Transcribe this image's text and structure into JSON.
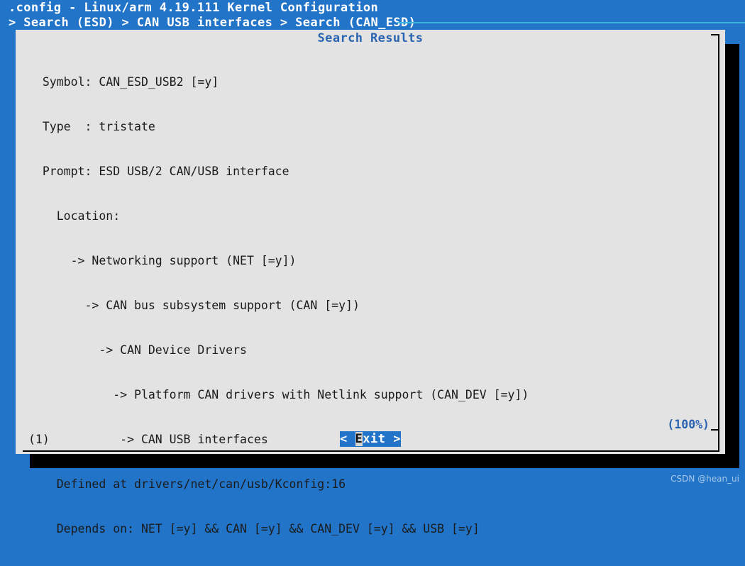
{
  "header": {
    "title": ".config - Linux/arm 4.19.111 Kernel Configuration",
    "breadcrumb": "> Search (ESD) > CAN USB interfaces > Search (CAN_ESD)"
  },
  "dialog": {
    "title": "Search Results",
    "lines": [
      "  Symbol: CAN_ESD_USB2 [=y]",
      "  Type  : tristate",
      "  Prompt: ESD USB/2 CAN/USB interface",
      "    Location:",
      "      -> Networking support (NET [=y])",
      "        -> CAN bus subsystem support (CAN [=y])",
      "          -> CAN Device Drivers",
      "            -> Platform CAN drivers with Netlink support (CAN_DEV [=y])",
      "(1)          -> CAN USB interfaces",
      "    Defined at drivers/net/can/usb/Kconfig:16",
      "    Depends on: NET [=y] && CAN [=y] && CAN_DEV [=y] && USB [=y]"
    ],
    "percent": "(100%)",
    "exit_button": {
      "prefix": "< ",
      "hotkey": "E",
      "rest": "xit >"
    }
  },
  "watermark": "CSDN @hean_ui",
  "colors": {
    "background_blue": "#2274c8",
    "dialog_background": "#e3e3e3",
    "accent_blue": "#2a63b0",
    "rule_cyan": "#3ab7d8",
    "shadow": "#000000",
    "text": "#1b1b1b",
    "header_text": "#ffffff"
  }
}
